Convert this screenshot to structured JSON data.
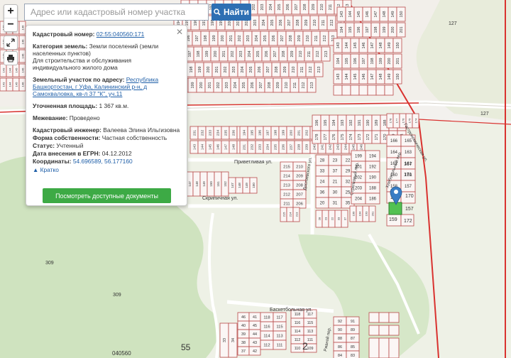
{
  "search": {
    "placeholder": "Адрес или кадастровый номер участка",
    "button_label": "Найти"
  },
  "zoom": {
    "in_label": "+",
    "out_label": "−"
  },
  "popup": {
    "cadastral_number_label": "Кадастровый номер:",
    "cadastral_number_value": "02:55:040560:171",
    "land_category_label": "Категория земель:",
    "land_category_value": "Земли поселений (земли населенных пунктов)",
    "permitted_use": "Для строительства и обслуживания индивидуального жилого дома",
    "address_label": "Земельный участок по адресу:",
    "address_value": "Республика Башкортостан, г Уфа, Калининский р-н, д Самохваловка, кв-л 37 \"К\", уч.11",
    "area_label": "Уточненная площадь:",
    "area_value": "1 367 кв.м.",
    "survey_label": "Межевание:",
    "survey_value": "Проведено",
    "engineer_label": "Кадастровый инженер:",
    "engineer_value": "Валеева Элина Ильгизовна",
    "ownership_label": "Форма собственности:",
    "ownership_value": "Частная собственность",
    "status_label": "Статус:",
    "status_value": "Учтенный",
    "egrn_date_label": "Дата внесения в ЕГРН:",
    "egrn_date_value": "04.12.2012",
    "coords_label": "Координаты:",
    "coords_value": "54.696589, 56.177160",
    "brief_link": "Кратко",
    "docs_button": "Посмотреть доступные документы"
  },
  "map": {
    "streets": {
      "privetlivaya": "Приветливая ул.",
      "skrinichnaya": "Скрипичная ул.",
      "basketbolnaya": "Баскетбольная ул.",
      "dostoevskogo": "Достоевского ул.",
      "khlebosolny": "Хлебосольный пер.",
      "strelkovy": "Стрелковый пер.",
      "gastronomicheskaya": "Гастрономическая ул.",
      "rzhanoy": "Ржаной пер."
    },
    "region_labels": {
      "r127a": "127",
      "r127b": "127",
      "r309a": "309",
      "r309b": "309",
      "quarter": "040560",
      "z55": "55",
      "z2": "2"
    },
    "colors": {
      "parcel_border": "#b94a4a",
      "boundary": "#d9322f",
      "forest": "#cfe3bf",
      "field": "#e7ecd9",
      "selected": "#52c152",
      "marker": "#3a7dc4"
    },
    "grid_rows": [
      {
        "id": "top",
        "labels": [
          "194",
          "195",
          "196",
          "197",
          "198",
          "199",
          "200",
          "201",
          "202",
          "203",
          "204",
          "205",
          "206",
          "207",
          "208",
          "209",
          "210",
          "211",
          "212",
          "213",
          "214"
        ]
      },
      {
        "id": "top2",
        "labels": [
          "143",
          "144",
          "145",
          "146",
          "147",
          "148",
          "149",
          "150",
          "151",
          "152",
          "153",
          "154",
          "155",
          "156",
          "157",
          "158",
          "159",
          "160",
          "161",
          "162"
        ]
      },
      {
        "id": "mid1",
        "labels": [
          "231",
          "232",
          "233",
          "234",
          "235",
          "236",
          "237",
          "238",
          "239",
          "240",
          "241",
          "242",
          "243",
          "244",
          "245",
          "246"
        ]
      },
      {
        "id": "mid2",
        "labels": [
          "147",
          "148",
          "149",
          "150",
          "151",
          "152",
          "153",
          "154",
          "155",
          "156",
          "157",
          "158"
        ]
      },
      {
        "id": "block1",
        "labels": [
          "28",
          "23",
          "22",
          "33",
          "37",
          "29",
          "24",
          "21",
          "32",
          "36",
          "30",
          "25",
          "20",
          "31",
          "35"
        ]
      },
      {
        "id": "block2",
        "labels": [
          "199",
          "194",
          "193",
          "201",
          "192",
          "191",
          "202",
          "190",
          "189",
          "203",
          "188",
          "187",
          "204",
          "186",
          "185"
        ]
      },
      {
        "id": "block3",
        "labels": [
          "166",
          "165",
          "164",
          "163",
          "162",
          "161",
          "160",
          "159",
          "158",
          "157",
          "156"
        ]
      },
      {
        "id": "right1",
        "labels": [
          "178",
          "177",
          "176",
          "175",
          "174",
          "173",
          "172",
          "171",
          "170",
          "169",
          "168"
        ]
      },
      {
        "id": "right2",
        "labels": [
          "196",
          "195",
          "194",
          "193",
          "192",
          "191",
          "190",
          "189",
          "188",
          "187",
          "186"
        ]
      },
      {
        "id": "left1",
        "labels": [
          "215",
          "214",
          "213",
          "212",
          "211",
          "210",
          "209",
          "208",
          "207",
          "206"
        ]
      },
      {
        "id": "bottom",
        "labels": [
          "46",
          "41",
          "40",
          "45",
          "39",
          "44",
          "38",
          "43",
          "37",
          "42",
          "118",
          "117",
          "116",
          "115",
          "114",
          "113",
          "112",
          "111",
          "110",
          "109",
          "92",
          "91",
          "90",
          "89",
          "88",
          "87",
          "86",
          "85",
          "84",
          "83"
        ]
      },
      {
        "id": "bottom2",
        "labels": [
          "33",
          "34",
          "35",
          "36",
          "52",
          "53",
          "54",
          "55",
          "56",
          "57",
          "58",
          "59",
          "60",
          "61",
          "62",
          "63"
        ]
      }
    ],
    "plot_labels": [
      "159",
      "172",
      "157",
      "170",
      "171",
      "167",
      "168",
      "169"
    ]
  }
}
